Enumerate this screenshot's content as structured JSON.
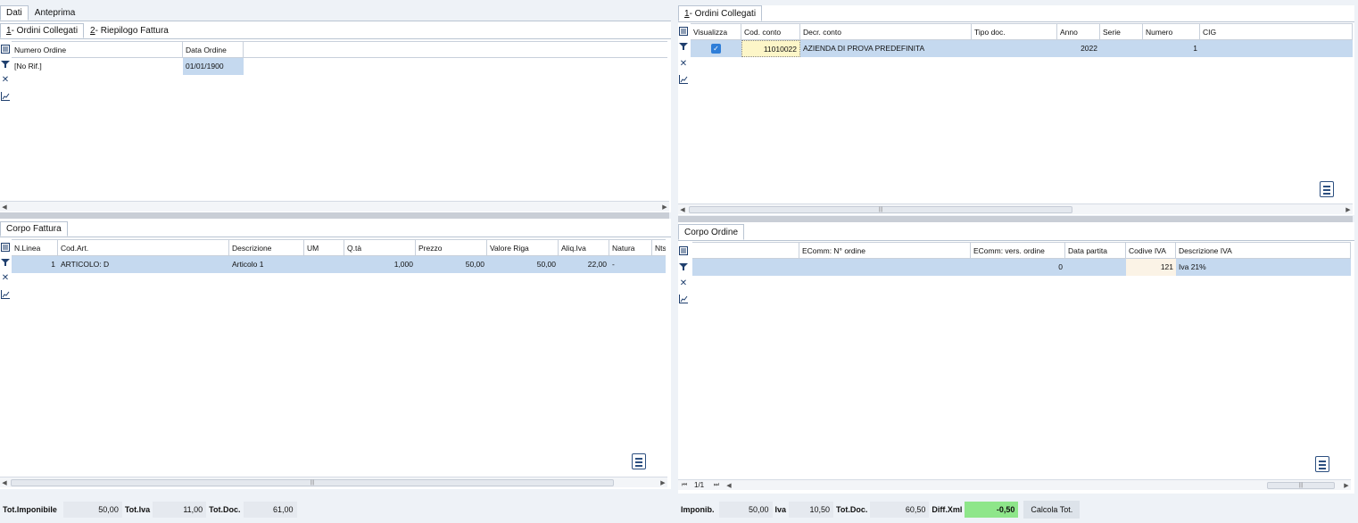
{
  "top_tabs": [
    "Dati",
    "Anteprima"
  ],
  "left": {
    "sub_tabs": [
      {
        "key": "1",
        "label": " - Ordini Collegati"
      },
      {
        "key": "2",
        "label": " - Riepilogo Fattura"
      }
    ],
    "ordini": {
      "columns": [
        "Numero Ordine",
        "Data Ordine"
      ],
      "rows": [
        [
          "[No Rif.]",
          "01/01/1900"
        ]
      ]
    },
    "corpo_tab": "Corpo Fattura",
    "corpo": {
      "columns": [
        "N.Linea",
        "Cod.Art.",
        "Descrizione",
        "UM",
        "Q.tà",
        "Prezzo",
        "Valore Riga",
        "Aliq.Iva",
        "Natura",
        "Nts"
      ],
      "rows": [
        [
          "1",
          "ARTICOLO: D",
          "Articolo 1",
          "",
          "1,000",
          "50,00",
          "50,00",
          "22,00",
          "-",
          ""
        ]
      ]
    },
    "footer": {
      "imponibile_label": "Tot.Imponibile",
      "imponibile": "50,00",
      "iva_label": "Tot.Iva",
      "iva": "11,00",
      "doc_label": "Tot.Doc.",
      "doc": "61,00"
    }
  },
  "right": {
    "tab": {
      "key": "1",
      "label": " - Ordini Collegati"
    },
    "ordini": {
      "columns": [
        "Visualizza",
        "Cod. conto",
        "Decr. conto",
        "Tipo doc.",
        "Anno",
        "Serie",
        "Numero",
        "CIG"
      ],
      "rows": [
        [
          "✓",
          "11010022",
          "AZIENDA DI PROVA PREDEFINITA",
          "",
          "2022",
          "",
          "1",
          ""
        ]
      ]
    },
    "corpo_tab": "Corpo Ordine",
    "corpo": {
      "columns": [
        "",
        "EComm: N° ordine",
        "EComm: vers. ordine",
        "Data partita",
        "Codive IVA",
        "Descrizione IVA"
      ],
      "rows": [
        [
          "",
          "",
          "0",
          "",
          "121",
          "Iva 21%"
        ]
      ]
    },
    "pager": "1/1",
    "footer": {
      "imponibile_label": "Imponib.",
      "imponibile": "50,00",
      "iva_label": "Iva",
      "iva": "10,50",
      "doc_label": "Tot.Doc.",
      "doc": "60,50",
      "diff_label": "Diff.Xml",
      "diff": "-0,50",
      "diff_color": "#8ee68a",
      "calc_button": "Calcola Tot."
    }
  }
}
